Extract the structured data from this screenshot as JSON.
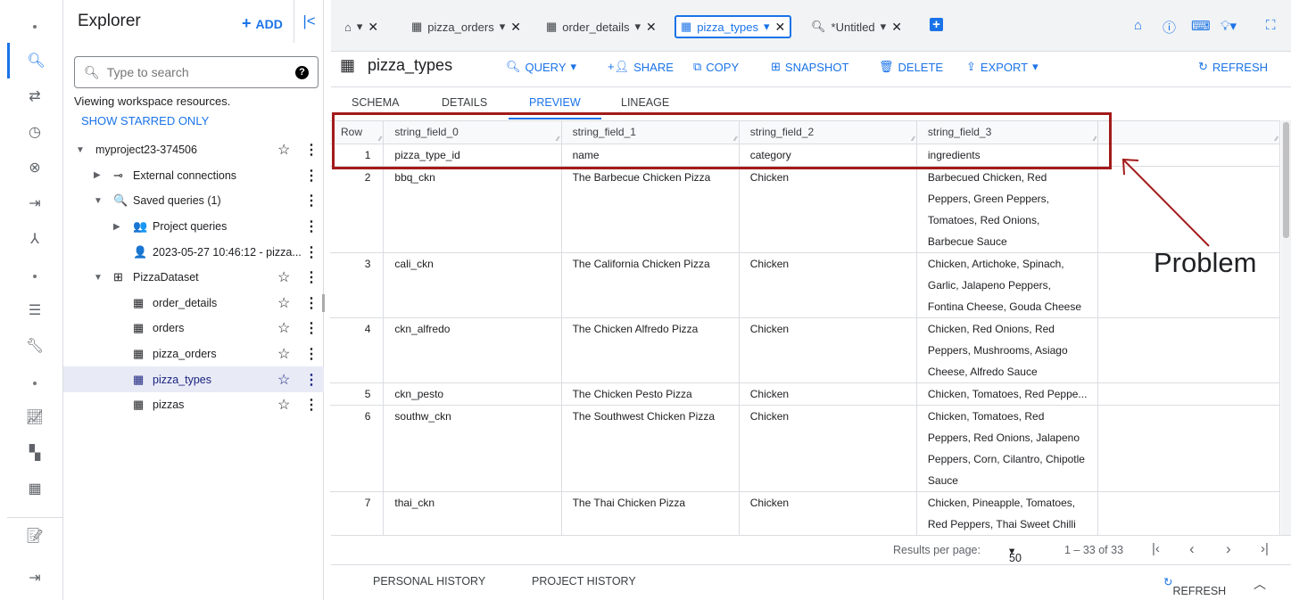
{
  "rail": {
    "icons": [
      "dot",
      "search-icon",
      "transfer-icon",
      "clock-icon",
      "analytics-hub-icon",
      "dataflow-icon",
      "dataform-icon",
      "dot",
      "list-icon",
      "wrench-icon",
      "dot",
      "chart-icon",
      "dashboard-icon",
      "table-icon",
      "notes-icon",
      "expand-icon"
    ]
  },
  "explorer": {
    "title": "Explorer",
    "add_label": "ADD",
    "search_placeholder": "Type to search",
    "viewing": "Viewing workspace resources.",
    "starred": "SHOW STARRED ONLY",
    "tree": [
      {
        "label": "myproject23-374506",
        "level": 0,
        "arrow": "▼",
        "icon": "",
        "star": true
      },
      {
        "label": "External connections",
        "level": 1,
        "arrow": "▶",
        "icon": "⊸",
        "star": false
      },
      {
        "label": "Saved queries (1)",
        "level": 1,
        "arrow": "▼",
        "icon": "🔍",
        "star": false
      },
      {
        "label": "Project queries",
        "level": 2,
        "arrow": "▶",
        "icon": "👥",
        "star": false
      },
      {
        "label": "2023-05-27 10:46:12 - pizza...",
        "level": 2,
        "arrow": "",
        "icon": "👤",
        "star": false
      },
      {
        "label": "PizzaDataset",
        "level": 1,
        "arrow": "▼",
        "icon": "⊞",
        "star": true
      },
      {
        "label": "order_details",
        "level": 2,
        "arrow": "",
        "icon": "▦",
        "star": true
      },
      {
        "label": "orders",
        "level": 2,
        "arrow": "",
        "icon": "▦",
        "star": true
      },
      {
        "label": "pizza_orders",
        "level": 2,
        "arrow": "",
        "icon": "▦",
        "star": true
      },
      {
        "label": "pizza_types",
        "level": 2,
        "arrow": "",
        "icon": "▦",
        "star": true,
        "selected": true
      },
      {
        "label": "pizzas",
        "level": 2,
        "arrow": "",
        "icon": "▦",
        "star": true
      }
    ]
  },
  "tabs": [
    {
      "label": "",
      "icon": "home-icon"
    },
    {
      "label": "pizza_orders"
    },
    {
      "label": "order_details"
    },
    {
      "label": "pizza_types",
      "active": true
    },
    {
      "label": "*Untitled"
    }
  ],
  "toolbar": {
    "title": "pizza_types",
    "query": "QUERY",
    "share": "SHARE",
    "copy": "COPY",
    "snapshot": "SNAPSHOT",
    "delete": "DELETE",
    "export": "EXPORT",
    "refresh": "REFRESH"
  },
  "subtabs": [
    "SCHEMA",
    "DETAILS",
    "PREVIEW",
    "LINEAGE"
  ],
  "table": {
    "columns": [
      "Row",
      "string_field_0",
      "string_field_1",
      "string_field_2",
      "string_field_3"
    ],
    "rows": [
      [
        "1",
        "pizza_type_id",
        "name",
        "category",
        "ingredients"
      ],
      [
        "2",
        "bbq_ckn",
        "The Barbecue Chicken Pizza",
        "Chicken",
        "Barbecued Chicken, Red Peppers, Green Peppers, Tomatoes, Red Onions, Barbecue Sauce"
      ],
      [
        "3",
        "cali_ckn",
        "The California Chicken Pizza",
        "Chicken",
        "Chicken, Artichoke, Spinach, Garlic, Jalapeno Peppers, Fontina Cheese, Gouda Cheese"
      ],
      [
        "4",
        "ckn_alfredo",
        "The Chicken Alfredo Pizza",
        "Chicken",
        "Chicken, Red Onions, Red Peppers, Mushrooms, Asiago Cheese, Alfredo Sauce"
      ],
      [
        "5",
        "ckn_pesto",
        "The Chicken Pesto Pizza",
        "Chicken",
        "Chicken, Tomatoes, Red Peppe..."
      ],
      [
        "6",
        "southw_ckn",
        "The Southwest Chicken Pizza",
        "Chicken",
        "Chicken, Tomatoes, Red Peppers, Red Onions, Jalapeno Peppers, Corn, Cilantro, Chipotle Sauce"
      ],
      [
        "7",
        "thai_ckn",
        "The Thai Chicken Pizza",
        "Chicken",
        "Chicken, Pineapple, Tomatoes, Red Peppers, Thai Sweet Chilli Sauce"
      ]
    ]
  },
  "pager": {
    "label": "Results per page:",
    "per_page": "50",
    "range": "1 – 33 of 33"
  },
  "history": {
    "personal": "PERSONAL HISTORY",
    "project": "PROJECT HISTORY",
    "refresh": "REFRESH"
  },
  "annotation": {
    "text": "Problem",
    "color": "#a31a1a"
  }
}
